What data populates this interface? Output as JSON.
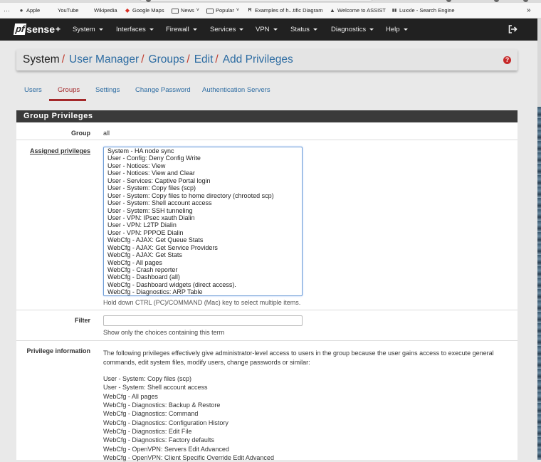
{
  "bookmarks": [
    {
      "label": "Apple",
      "icon": "apple-icon"
    },
    {
      "label": "YouTube",
      "icon": ""
    },
    {
      "label": "Wikipedia",
      "icon": ""
    },
    {
      "label": "Google Maps",
      "icon": "google-maps-icon"
    },
    {
      "label": "News",
      "icon": "folder-icon",
      "dropdown": true
    },
    {
      "label": "Popular",
      "icon": "folder-icon",
      "dropdown": true
    },
    {
      "label": "Examples of h...tific Diagram",
      "icon": "researchgate-icon"
    },
    {
      "label": "Welcome to ASSIST",
      "icon": "assist-icon"
    },
    {
      "label": "Luxxle - Search Engine",
      "icon": "luxxle-icon"
    }
  ],
  "navbar": {
    "logo_pf": "pf",
    "logo_sense": "sense",
    "menu": [
      "System",
      "Interfaces",
      "Firewall",
      "Services",
      "VPN",
      "Status",
      "Diagnostics",
      "Help"
    ]
  },
  "breadcrumb": {
    "root": "System",
    "links": [
      "User Manager",
      "Groups",
      "Edit",
      "Add Privileges"
    ],
    "separator": "/",
    "help_glyph": "?"
  },
  "tabs": [
    "Users",
    "Groups",
    "Settings",
    "Change Password",
    "Authentication Servers"
  ],
  "active_tab": "Groups",
  "panel": {
    "title": "Group Privileges",
    "group_label": "Group",
    "group_value": "all",
    "privileges_label": "Assigned privileges",
    "privileges_options": [
      "System - HA node sync",
      "User - Config: Deny Config Write",
      "User - Notices: View",
      "User - Notices: View and Clear",
      "User - Services: Captive Portal login",
      "User - System: Copy files (scp)",
      "User - System: Copy files to home directory (chrooted scp)",
      "User - System: Shell account access",
      "User - System: SSH tunneling",
      "User - VPN: IPsec xauth Dialin",
      "User - VPN: L2TP Dialin",
      "User - VPN: PPPOE Dialin",
      "WebCfg - AJAX: Get Queue Stats",
      "WebCfg - AJAX: Get Service Providers",
      "WebCfg - AJAX: Get Stats",
      "WebCfg - All pages",
      "WebCfg - Crash reporter",
      "WebCfg - Dashboard (all)",
      "WebCfg - Dashboard widgets (direct access).",
      "WebCfg - Diagnostics: ARP Table"
    ],
    "privileges_hint": "Hold down CTRL (PC)/COMMAND (Mac) key to select multiple items.",
    "filter_label": "Filter",
    "filter_value": "",
    "filter_hint": "Show only the choices containing this term",
    "info_label": "Privilege information",
    "info_text": "The following privileges effectively give administrator-level access to users in the group because the user gains access to execute general commands, edit system files, modify users, change passwords or similar:",
    "info_privileges": [
      "User - System: Copy files (scp)",
      "User - System: Shell account access",
      "WebCfg - All pages",
      "WebCfg - Diagnostics: Backup & Restore",
      "WebCfg - Diagnostics: Command",
      "WebCfg - Diagnostics: Configuration History",
      "WebCfg - Diagnostics: Edit File",
      "WebCfg - Diagnostics: Factory defaults",
      "WebCfg - OpenVPN: Servers Edit Advanced",
      "WebCfg - OpenVPN: Client Specific Override Edit Advanced"
    ]
  },
  "colors": {
    "navbar": "#212121",
    "link": "#2d6ca2",
    "active_tab": "#a4282a",
    "panel_header": "#3a3a3a",
    "help_icon": "#c62828"
  }
}
